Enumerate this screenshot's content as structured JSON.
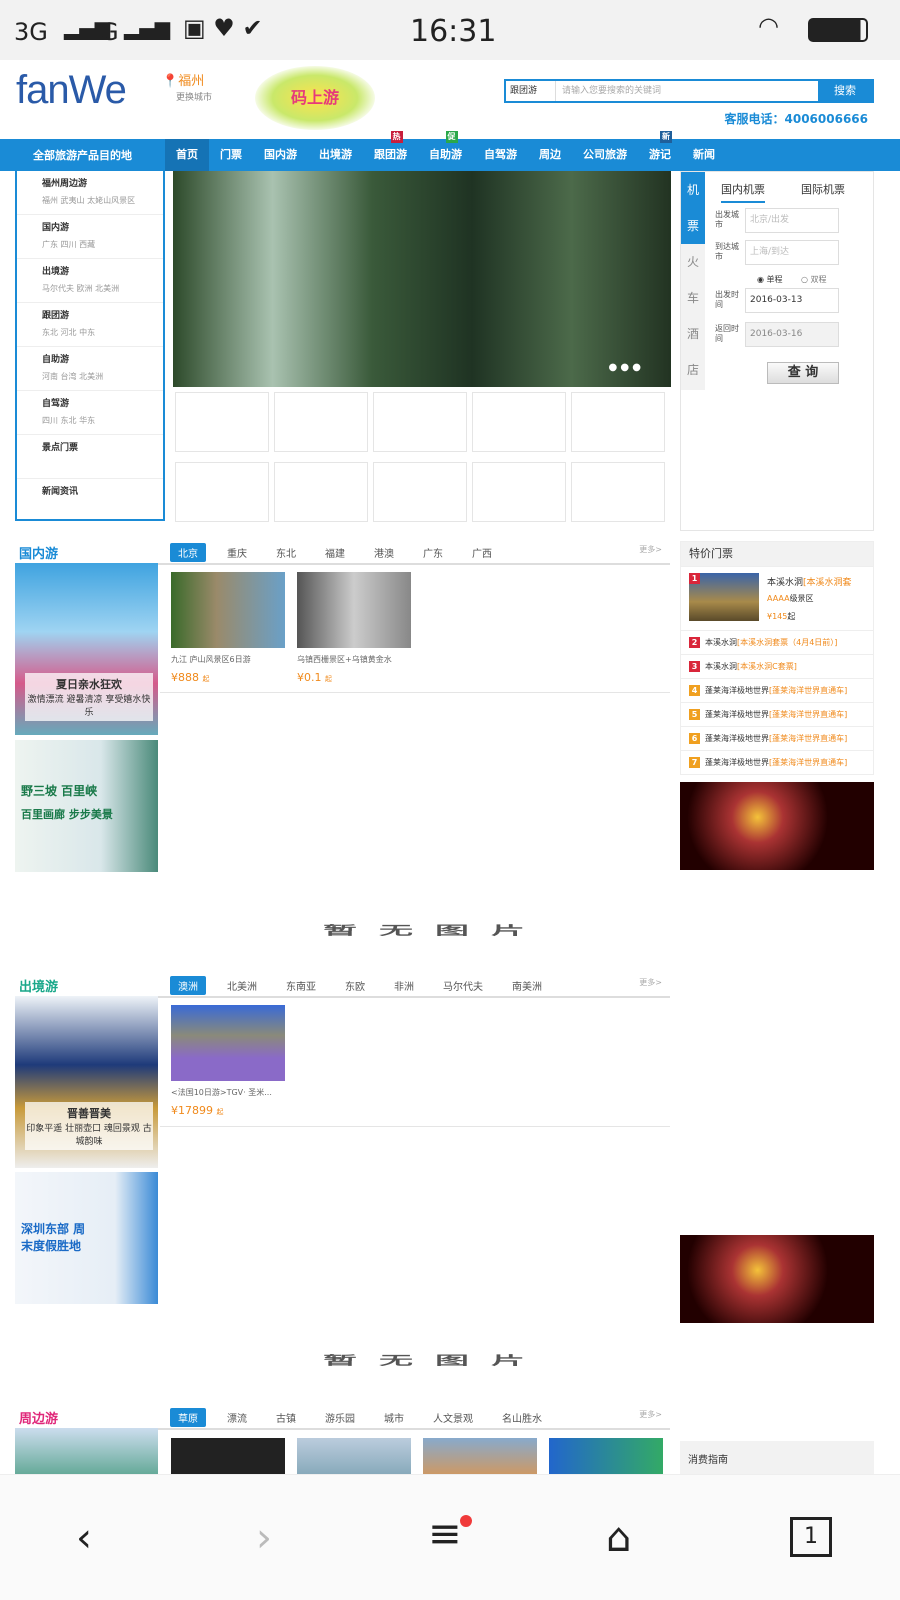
{
  "status_bar": {
    "network1": "3G",
    "network2": "G",
    "time": "16:31"
  },
  "header": {
    "logo": "fanWe",
    "city": "福州",
    "change_city": "更换城市",
    "promo": "码上游",
    "search": {
      "category": "跟团游",
      "placeholder": "请输入您要搜索的关键词",
      "button": "搜索"
    },
    "hotline": "客服电话：4006006666"
  },
  "nav": {
    "all": "全部旅游产品目的地",
    "items": [
      {
        "label": "首页"
      },
      {
        "label": "门票"
      },
      {
        "label": "国内游"
      },
      {
        "label": "出境游"
      },
      {
        "label": "跟团游",
        "tag": "热"
      },
      {
        "label": "自助游",
        "tag": "促"
      },
      {
        "label": "自驾游"
      },
      {
        "label": "周边"
      },
      {
        "label": "公司旅游"
      },
      {
        "label": "游记",
        "tag": "新"
      },
      {
        "label": "新闻"
      }
    ]
  },
  "sidebar": [
    {
      "title": "福州周边游",
      "sub": "福州 武夷山 太姥山风景区"
    },
    {
      "title": "国内游",
      "sub": "广东 四川 西藏"
    },
    {
      "title": "出境游",
      "sub": "马尔代夫 欧洲 北美洲"
    },
    {
      "title": "跟团游",
      "sub": "东北 河北 中东"
    },
    {
      "title": "自助游",
      "sub": "河南 台湾 北美洲"
    },
    {
      "title": "自驾游",
      "sub": "四川 东北 华东"
    },
    {
      "title": "景点门票",
      "sub": ""
    },
    {
      "title": "新闻资讯",
      "sub": ""
    }
  ],
  "booking": {
    "side_tabs": [
      "机",
      "票",
      "火",
      "车",
      "酒",
      "店"
    ],
    "tabs": [
      "国内机票",
      "国际机票"
    ],
    "depart_label": "出发城市",
    "depart_ph": "北京/出发",
    "arrive_label": "到达城市",
    "arrive_ph": "上海/到达",
    "one_way": "单程",
    "round": "双程",
    "date_label": "出发时间",
    "date": "2016-03-13",
    "return_label": "返回时间",
    "return_date": "2016-03-16",
    "query": "查 询"
  },
  "domestic": {
    "title": "国内游",
    "tabs": [
      "北京",
      "重庆",
      "东北",
      "福建",
      "港澳",
      "广东",
      "广西"
    ],
    "more": "更多>",
    "banner1": {
      "title": "夏日亲水狂欢",
      "sub": "激情漂流 避暑清凉 享受嬉水快乐"
    },
    "banner2": {
      "title": "野三坡 百里峡",
      "sub": "百里画廊 步步美景"
    },
    "products": [
      {
        "name": "九江 庐山风景区6日游",
        "price": "¥888",
        "unit": "起"
      },
      {
        "name": "乌镇西栅景区+乌镇黄金水",
        "price": "¥0.1",
        "unit": "起"
      }
    ]
  },
  "deals": {
    "title": "特价门票",
    "top": {
      "name": "本溪水洞",
      "tag": "[本溪水洞套",
      "level": "AAAA",
      "level_suffix": "级景区",
      "price": "¥145",
      "unit": "起"
    },
    "items": [
      {
        "n": "2",
        "name": "本溪水洞",
        "tag": "[本溪水洞套票（4月4日前）]"
      },
      {
        "n": "3",
        "name": "本溪水洞",
        "tag": "[本溪水洞C套票]"
      },
      {
        "n": "4",
        "name": "蓬莱海洋极地世界",
        "tag": "[蓬莱海洋世界直通车]"
      },
      {
        "n": "5",
        "name": "蓬莱海洋极地世界",
        "tag": "[蓬莱海洋世界直通车]"
      },
      {
        "n": "6",
        "name": "蓬莱海洋极地世界",
        "tag": "[蓬莱海洋世界直通车]"
      },
      {
        "n": "7",
        "name": "蓬莱海洋极地世界",
        "tag": "[蓬莱海洋世界直通车]"
      }
    ]
  },
  "no_image": "暂无图片",
  "outbound": {
    "title": "出境游",
    "tabs": [
      "澳洲",
      "北美洲",
      "东南亚",
      "东欧",
      "非洲",
      "马尔代夫",
      "南美洲"
    ],
    "more": "更多>",
    "banner1": {
      "title": "晋善晋美",
      "sub": "印象平遥 壮丽壶口 魂回景观 古城韵味"
    },
    "banner2": {
      "title": "深圳东部 周末度假胜地"
    },
    "products": [
      {
        "name": "<法国10日游>TGV· 圣米...",
        "price": "¥17899",
        "unit": "起"
      }
    ]
  },
  "nearby": {
    "title": "周边游",
    "tabs": [
      "草原",
      "漂流",
      "古镇",
      "游乐园",
      "城市",
      "人文景观",
      "名山胜水"
    ],
    "more": "更多>",
    "guide": "消费指南"
  },
  "colors": {
    "brand": "#1a8bd6",
    "orange": "#f08a1c"
  }
}
